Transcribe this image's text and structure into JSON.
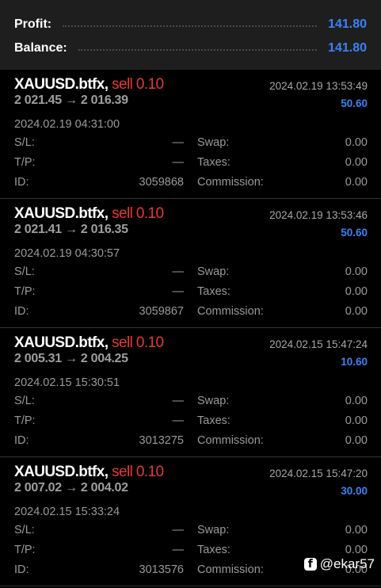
{
  "summary": {
    "profit_label": "Profit:",
    "profit_value": "141.80",
    "balance_label": "Balance:",
    "balance_value": "141.80"
  },
  "labels": {
    "sl": "S/L:",
    "tp": "T/P:",
    "id": "ID:",
    "swap": "Swap:",
    "taxes": "Taxes:",
    "commission": "Commission:"
  },
  "deals": [
    {
      "symbol": "XAUUSD.btfx,",
      "side": "sell 0.10",
      "close_time": "2024.02.19 13:53:49",
      "prices": "2 021.45 → 2 016.39",
      "profit": "50.60",
      "open_time": "2024.02.19 04:31:00",
      "sl": "—",
      "tp": "—",
      "id": "3059868",
      "swap": "0.00",
      "taxes": "0.00",
      "commission": "0.00"
    },
    {
      "symbol": "XAUUSD.btfx,",
      "side": "sell 0.10",
      "close_time": "2024.02.19 13:53:46",
      "prices": "2 021.41 → 2 016.35",
      "profit": "50.60",
      "open_time": "2024.02.19 04:30:57",
      "sl": "—",
      "tp": "—",
      "id": "3059867",
      "swap": "0.00",
      "taxes": "0.00",
      "commission": "0.00"
    },
    {
      "symbol": "XAUUSD.btfx,",
      "side": "sell 0.10",
      "close_time": "2024.02.15 15:47:24",
      "prices": "2 005.31 → 2 004.25",
      "profit": "10.60",
      "open_time": "2024.02.15 15:30:51",
      "sl": "—",
      "tp": "—",
      "id": "3013275",
      "swap": "0.00",
      "taxes": "0.00",
      "commission": "0.00"
    },
    {
      "symbol": "XAUUSD.btfx,",
      "side": "sell 0.10",
      "close_time": "2024.02.15 15:47:20",
      "prices": "2 007.02 → 2 004.02",
      "profit": "30.00",
      "open_time": "2024.02.15 15:33:24",
      "sl": "—",
      "tp": "—",
      "id": "3013576",
      "swap": "0.00",
      "taxes": "0.00",
      "commission": "0.00"
    }
  ],
  "watermark": {
    "icon": "facebook-icon",
    "text": "@ekar57"
  },
  "colors": {
    "accent_blue": "#3b82f6",
    "sell_red": "#e53935",
    "summary_bg": "#1e1e1e"
  }
}
